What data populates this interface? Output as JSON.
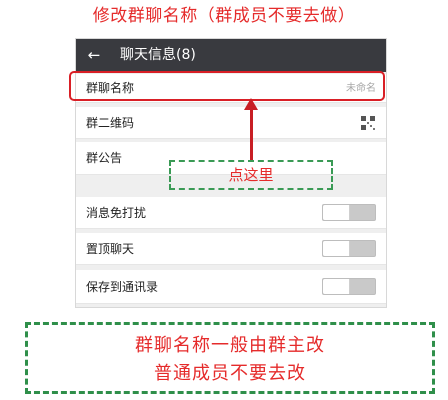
{
  "top_title": "修改群聊名称（群成员不要去做）",
  "header": {
    "back_icon": "arrow-left-icon",
    "title": "聊天信息(8)"
  },
  "rows": {
    "group_name": {
      "label": "群聊名称",
      "value": "未命名"
    },
    "qr_code": {
      "label": "群二维码",
      "icon": "qr-code-icon"
    },
    "announcement": {
      "label": "群公告"
    },
    "mute": {
      "label": "消息免打扰",
      "state": "off"
    },
    "pin": {
      "label": "置顶聊天",
      "state": "off"
    },
    "save_contacts": {
      "label": "保存到通讯录",
      "state": "off"
    }
  },
  "annotation": {
    "click_here": "点这里",
    "note_line1": "群聊名称一般由群主改",
    "note_line2": "普通成员不要去改"
  },
  "colors": {
    "annotation_red": "#e52b2b",
    "highlight_red": "#d91f26",
    "dashed_green": "#2f8f4a",
    "header_bg": "#393a3f"
  }
}
